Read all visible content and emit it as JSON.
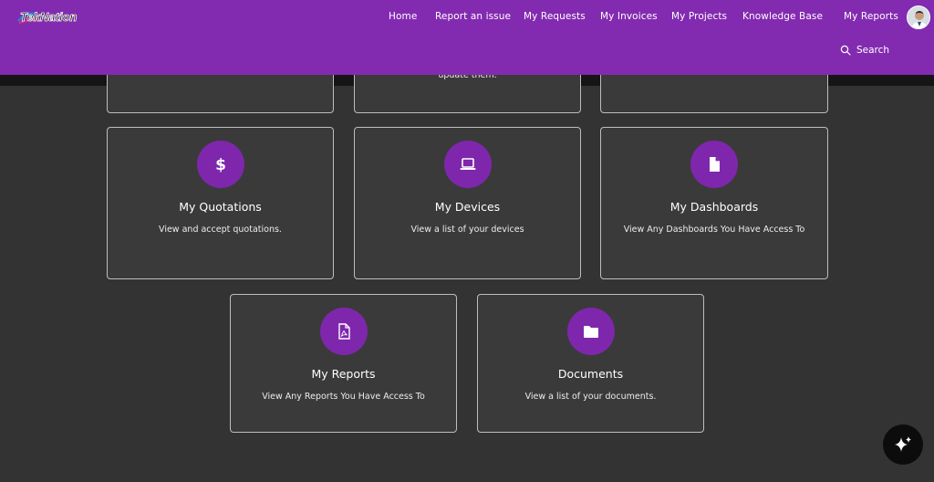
{
  "header": {
    "logo_text": "TekNation",
    "nav": [
      {
        "label": "Home"
      },
      {
        "label": "Report an issue"
      },
      {
        "label": "My Requests"
      },
      {
        "label": "My Invoices"
      },
      {
        "label": "My Projects"
      },
      {
        "label": "Knowledge Base"
      },
      {
        "label": "My Reports"
      }
    ],
    "search_label": "Search"
  },
  "partial_cards": [
    {
      "desc_fragment": ""
    },
    {
      "desc_fragment": "update them."
    },
    {
      "desc_fragment": ""
    }
  ],
  "cards": [
    {
      "title": "My Quotations",
      "desc": "View and accept quotations.",
      "icon": "dollar-icon"
    },
    {
      "title": "My Devices",
      "desc": "View a list of your devices",
      "icon": "laptop-icon"
    },
    {
      "title": "My Dashboards",
      "desc": "View Any Dashboards You Have Access To",
      "icon": "document-icon"
    },
    {
      "title": "My Reports",
      "desc": "View Any Reports You Have Access To",
      "icon": "pdf-file-icon"
    },
    {
      "title": "Documents",
      "desc": "View a list of your documents.",
      "icon": "folder-icon"
    }
  ],
  "colors": {
    "header_bg": "#832bb0",
    "icon_circle": "#7e27ac",
    "page_bg": "#333333",
    "card_bg": "#3a3a3a",
    "card_border": "#bdbdbd"
  }
}
